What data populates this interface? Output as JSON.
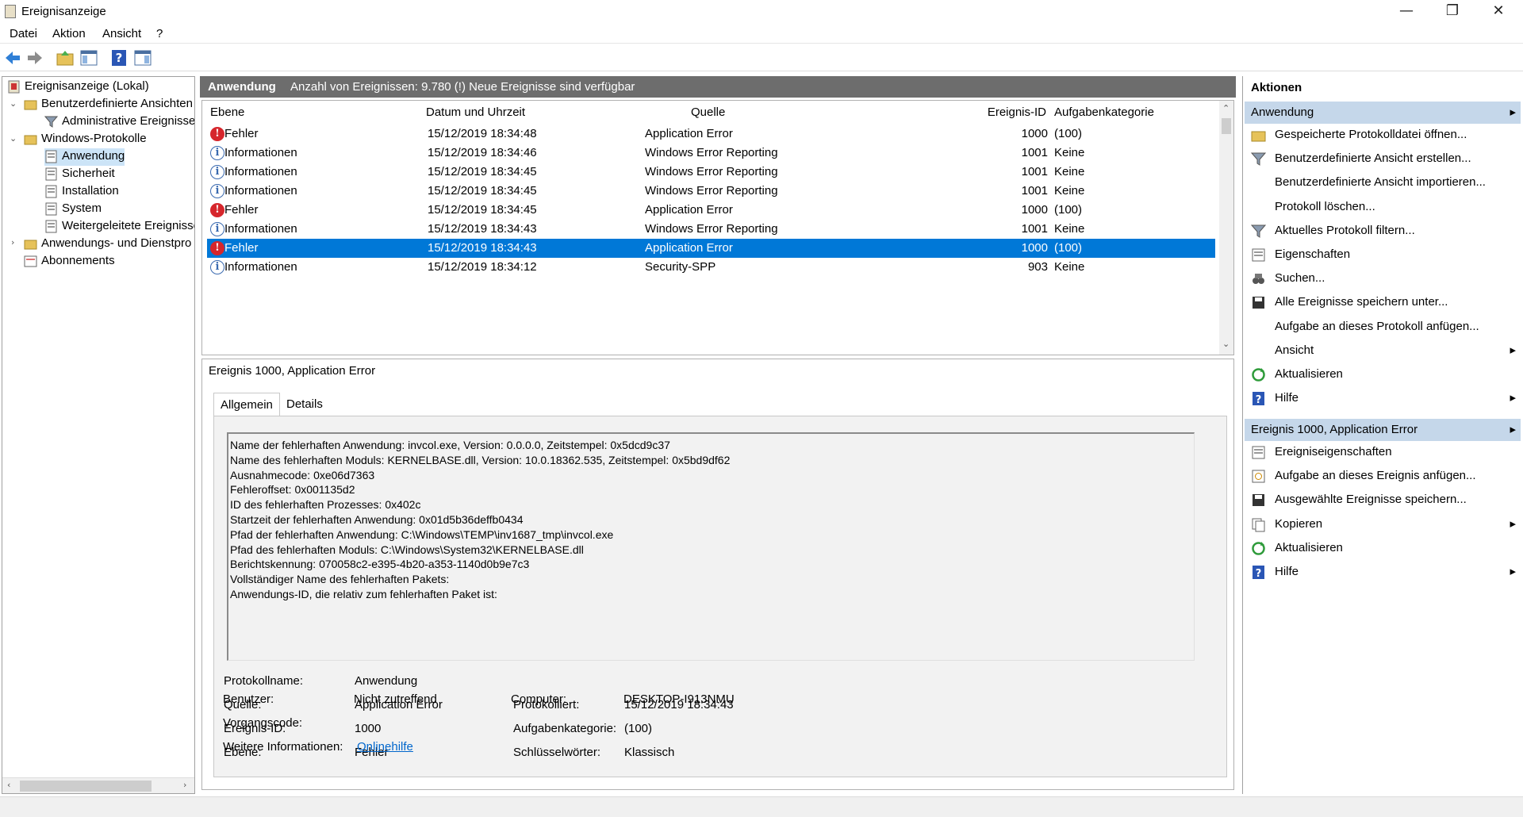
{
  "window": {
    "title": "Ereignisanzeige",
    "minimize": "—",
    "maximize": "❐",
    "close": "✕"
  },
  "menu": [
    "Datei",
    "Aktion",
    "Ansicht",
    "?"
  ],
  "toolbar": {
    "icons": [
      "back-arrow-icon",
      "forward-arrow-icon",
      "up-folder-icon",
      "show-hide-tree-icon",
      "help-icon",
      "show-hide-action-pane-icon"
    ]
  },
  "tree": {
    "root": "Ereignisanzeige (Lokal)",
    "custom_views": "Benutzerdefinierte Ansichten",
    "admin_events": "Administrative Ereignisse",
    "windows_logs": "Windows-Protokolle",
    "application": "Anwendung",
    "security": "Sicherheit",
    "setup": "Installation",
    "system": "System",
    "forwarded": "Weitergeleitete Ereignisse",
    "app_services": "Anwendungs- und Dienstpro",
    "subscriptions": "Abonnements"
  },
  "center": {
    "log_name": "Anwendung",
    "event_count": "Anzahl von Ereignissen: 9.780 (!) Neue Ereignisse sind verfügbar"
  },
  "table": {
    "columns": [
      "Ebene",
      "Datum und Uhrzeit",
      "Quelle",
      "Ereignis-ID",
      "Aufgabenkategorie"
    ],
    "rows": [
      {
        "level": "Fehler",
        "type": "err",
        "date": "15/12/2019 18:34:48",
        "source": "Application Error",
        "id": "1000",
        "category": "(100)"
      },
      {
        "level": "Informationen",
        "type": "inf",
        "date": "15/12/2019 18:34:46",
        "source": "Windows Error Reporting",
        "id": "1001",
        "category": "Keine"
      },
      {
        "level": "Informationen",
        "type": "inf",
        "date": "15/12/2019 18:34:45",
        "source": "Windows Error Reporting",
        "id": "1001",
        "category": "Keine"
      },
      {
        "level": "Informationen",
        "type": "inf",
        "date": "15/12/2019 18:34:45",
        "source": "Windows Error Reporting",
        "id": "1001",
        "category": "Keine"
      },
      {
        "level": "Fehler",
        "type": "err",
        "date": "15/12/2019 18:34:45",
        "source": "Application Error",
        "id": "1000",
        "category": "(100)"
      },
      {
        "level": "Informationen",
        "type": "inf",
        "date": "15/12/2019 18:34:43",
        "source": "Windows Error Reporting",
        "id": "1001",
        "category": "Keine"
      },
      {
        "level": "Fehler",
        "type": "err",
        "date": "15/12/2019 18:34:43",
        "source": "Application Error",
        "id": "1000",
        "category": "(100)",
        "selected": true
      },
      {
        "level": "Informationen",
        "type": "inf",
        "date": "15/12/2019 18:34:12",
        "source": "Security-SPP",
        "id": "903",
        "category": "Keine"
      }
    ]
  },
  "detail": {
    "title": "Ereignis 1000, Application Error",
    "tabs": [
      "Allgemein",
      "Details"
    ],
    "description": [
      "Name der fehlerhaften Anwendung: invcol.exe, Version: 0.0.0.0, Zeitstempel: 0x5dcd9c37",
      "Name des fehlerhaften Moduls: KERNELBASE.dll, Version: 10.0.18362.535, Zeitstempel: 0x5bd9df62",
      "Ausnahmecode: 0xe06d7363",
      "Fehleroffset: 0x001135d2",
      "ID des fehlerhaften Prozesses: 0x402c",
      "Startzeit der fehlerhaften Anwendung: 0x01d5b36deffb0434",
      "Pfad der fehlerhaften Anwendung: C:\\Windows\\TEMP\\inv1687_tmp\\invcol.exe",
      "Pfad des fehlerhaften Moduls: C:\\Windows\\System32\\KERNELBASE.dll",
      "Berichtskennung: 070058c2-e395-4b20-a353-1140d0b9e7c3",
      "Vollständiger Name des fehlerhaften Pakets:",
      "Anwendungs-ID, die relativ zum fehlerhaften Paket ist:"
    ],
    "fields": {
      "log_label": "Protokollname:",
      "log_value": "Anwendung",
      "source_label": "Quelle:",
      "source_value": "Application Error",
      "logged_label": "Protokolliert:",
      "logged_value": "15/12/2019 18:34:43",
      "id_label": "Ereignis-ID:",
      "id_value": "1000",
      "task_label": "Aufgabenkategorie:",
      "task_value": "(100)",
      "level_label": "Ebene:",
      "level_value": "Fehler",
      "keywords_label": "Schlüsselwörter:",
      "keywords_value": "Klassisch",
      "user_label": "Benutzer:",
      "user_value": "Nicht zutreffend",
      "computer_label": "Computer:",
      "computer_value": "DESKTOP-I913NMU",
      "opcode_label": "Vorgangscode:",
      "more_label": "Weitere Informationen:",
      "more_link": "Onlinehilfe"
    }
  },
  "actions": {
    "title": "Aktionen",
    "section1": {
      "label": "Anwendung",
      "arrow": "▸"
    },
    "items1": [
      {
        "label": "Gespeicherte Protokolldatei öffnen...",
        "icon": "open-folder-icon"
      },
      {
        "label": "Benutzerdefinierte Ansicht erstellen...",
        "icon": "filter-icon"
      },
      {
        "label": "Benutzerdefinierte Ansicht importieren...",
        "icon": ""
      },
      {
        "label": "Protokoll löschen...",
        "icon": ""
      },
      {
        "label": "Aktuelles Protokoll filtern...",
        "icon": "filter-icon"
      },
      {
        "label": "Eigenschaften",
        "icon": "properties-icon"
      },
      {
        "label": "Suchen...",
        "icon": "binoculars-icon"
      },
      {
        "label": "Alle Ereignisse speichern unter...",
        "icon": "save-icon"
      },
      {
        "label": "Aufgabe an dieses Protokoll anfügen...",
        "icon": ""
      },
      {
        "label": "Ansicht",
        "icon": "",
        "arrow": "▸"
      },
      {
        "label": "Aktualisieren",
        "icon": "refresh-icon"
      },
      {
        "label": "Hilfe",
        "icon": "help-icon",
        "arrow": "▸"
      }
    ],
    "section2": {
      "label": "Ereignis 1000, Application Error",
      "arrow": "▸"
    },
    "items2": [
      {
        "label": "Ereigniseigenschaften",
        "icon": "properties-icon"
      },
      {
        "label": "Aufgabe an dieses Ereignis anfügen...",
        "icon": "task-icon"
      },
      {
        "label": "Ausgewählte Ereignisse speichern...",
        "icon": "save-icon"
      },
      {
        "label": "Kopieren",
        "icon": "copy-icon",
        "arrow": "▸"
      },
      {
        "label": "Aktualisieren",
        "icon": "refresh-icon"
      },
      {
        "label": "Hilfe",
        "icon": "help-icon",
        "arrow": "▸"
      }
    ]
  },
  "colors": {
    "selection": "#0078d7",
    "header_bg": "#6d6d6d",
    "action_header": "#c5d7ea",
    "error": "#d6262c",
    "info": "#3a6ab0"
  }
}
